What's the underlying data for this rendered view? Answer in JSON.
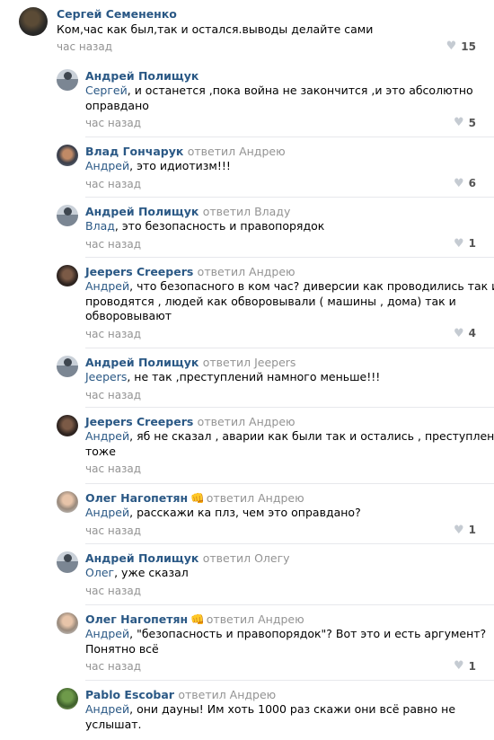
{
  "main": {
    "author": "Сергей Семененко",
    "text": "Ком,час как был,так и остался.выводы делайте сами",
    "time": "час назад",
    "likes": "15"
  },
  "replies": [
    {
      "author": "Андрей Полищук",
      "replied": "",
      "lines": [
        [
          "Сергей",
          ", и останется ,пока война не закончится ,и это абсолютно"
        ],
        [
          "",
          "оправдано"
        ]
      ],
      "time": "час назад",
      "likes": "5"
    },
    {
      "author": "Влад Гончарук",
      "replied": "ответил Андрею",
      "lines": [
        [
          "Андрей",
          ", это идиотизм!!!"
        ]
      ],
      "time": "час назад",
      "likes": "6"
    },
    {
      "author": "Андрей Полищук",
      "replied": "ответил Владу",
      "lines": [
        [
          "Влад",
          ", это безопасность и правопорядок"
        ]
      ],
      "time": "час назад",
      "likes": "1"
    },
    {
      "author": "Jeepers Creepers",
      "replied": "ответил Андрею",
      "lines": [
        [
          "Андрей",
          ", что безопасного в ком час? диверсии как проводились так и"
        ],
        [
          "",
          "проводятся , людей как обворовывали ( машины , дома) так и"
        ],
        [
          "",
          "обворовывают"
        ]
      ],
      "time": "час назад",
      "likes": "4"
    },
    {
      "author": "Андрей Полищук",
      "replied": "ответил Jeepers",
      "lines": [
        [
          "Jeepers",
          ", не так ,преступлений намного меньше!!!"
        ]
      ],
      "time": "час назад",
      "likes": ""
    },
    {
      "author": "Jeepers Creepers",
      "replied": "ответил Андрею",
      "lines": [
        [
          "Андрей",
          ", яб не сказал , аварии как были так и остались , преступления"
        ],
        [
          "",
          "тоже"
        ]
      ],
      "time": "час назад",
      "likes": ""
    },
    {
      "author": "Олег Нагопетян",
      "fist": "👊",
      "replied": "ответил Андрею",
      "lines": [
        [
          "Андрей",
          ", расскажи ка плз, чем это оправдано?"
        ]
      ],
      "time": "час назад",
      "likes": "1"
    },
    {
      "author": "Андрей Полищук",
      "replied": "ответил Олегу",
      "lines": [
        [
          "Олег",
          ", уже сказал"
        ]
      ],
      "time": "час назад",
      "likes": ""
    },
    {
      "author": "Олег Нагопетян",
      "fist": "👊",
      "replied": "ответил Андрею",
      "lines": [
        [
          "Андрей",
          ", \"безопасность и правопорядок\"? Вот это и есть аргумент?"
        ],
        [
          "",
          "Понятно всё"
        ]
      ],
      "time": "час назад",
      "likes": "1"
    },
    {
      "author": "Pablo Escobar",
      "replied": "ответил Андрею",
      "lines": [
        [
          "Андрей",
          ", они дауны! Им хоть 1000 раз скажи они всё равно не"
        ],
        [
          "",
          "услышат."
        ]
      ],
      "time": "",
      "likes": ""
    }
  ]
}
